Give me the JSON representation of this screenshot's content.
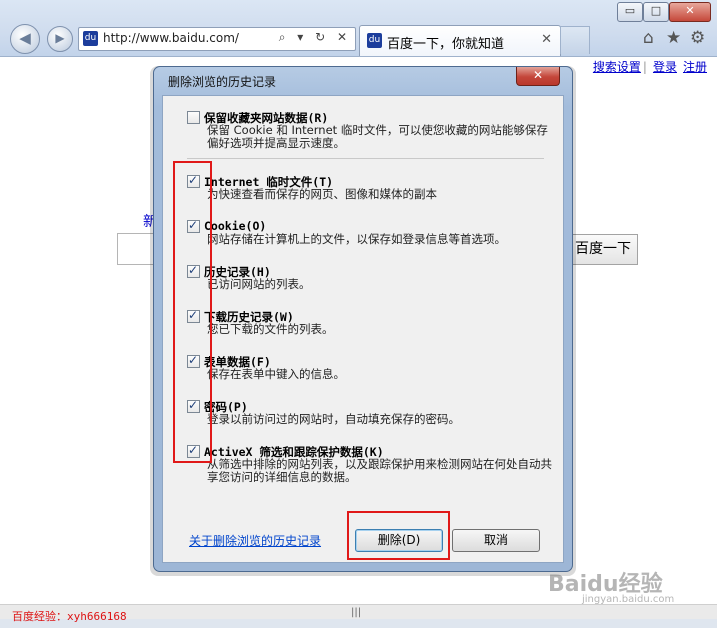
{
  "browser": {
    "window_controls": {
      "minimize": "▭",
      "maximize": "□",
      "close": "✕"
    },
    "back_icon": "back-arrow-icon",
    "forward_icon": "forward-arrow-icon",
    "address": {
      "url": "http://www.baidu.com/",
      "tools": "⌕ ▾ ↻ ✕"
    },
    "tab": {
      "title": "百度一下，你就知道",
      "close": "✕"
    },
    "right_icons": [
      "⌂",
      "★",
      "⚙"
    ]
  },
  "page": {
    "top_links": [
      "搜索设置",
      "登录",
      "注册"
    ],
    "partial_char": "新",
    "search_button": "百度一下"
  },
  "dialog": {
    "title": "删除浏览的历史记录",
    "close_label": "✕",
    "options": [
      {
        "label": "保留收藏夹网站数据(R)",
        "checked": false,
        "desc": "保留 Cookie 和 Internet 临时文件，可以使您收藏的网站能够保存偏好选项并提高显示速度。"
      },
      {
        "label": "Internet 临时文件(T)",
        "checked": true,
        "desc": "为快速查看而保存的网页、图像和媒体的副本"
      },
      {
        "label": "Cookie(O)",
        "checked": true,
        "desc": "网站存储在计算机上的文件，以保存如登录信息等首选项。"
      },
      {
        "label": "历史记录(H)",
        "checked": true,
        "desc": "已访问网站的列表。"
      },
      {
        "label": "下载历史记录(W)",
        "checked": true,
        "desc": "您已下载的文件的列表。"
      },
      {
        "label": "表单数据(F)",
        "checked": true,
        "desc": "保存在表单中键入的信息。"
      },
      {
        "label": "密码(P)",
        "checked": true,
        "desc": "登录以前访问过的网站时，自动填充保存的密码。"
      },
      {
        "label": "ActiveX 筛选和跟踪保护数据(K)",
        "checked": true,
        "desc": "从筛选中排除的网站列表，以及跟踪保护用来检测网站在何处自动共享您访问的详细信息的数据。"
      }
    ],
    "about_link": "关于删除浏览的历史记录",
    "delete_button": "删除(D)",
    "cancel_button": "取消"
  },
  "footer": {
    "watermark_text": "百度经验：xyh666168",
    "scroll_grip": "|||",
    "baidu_logo": "Baidu经验",
    "baidu_url": "jingyan.baidu.com"
  }
}
